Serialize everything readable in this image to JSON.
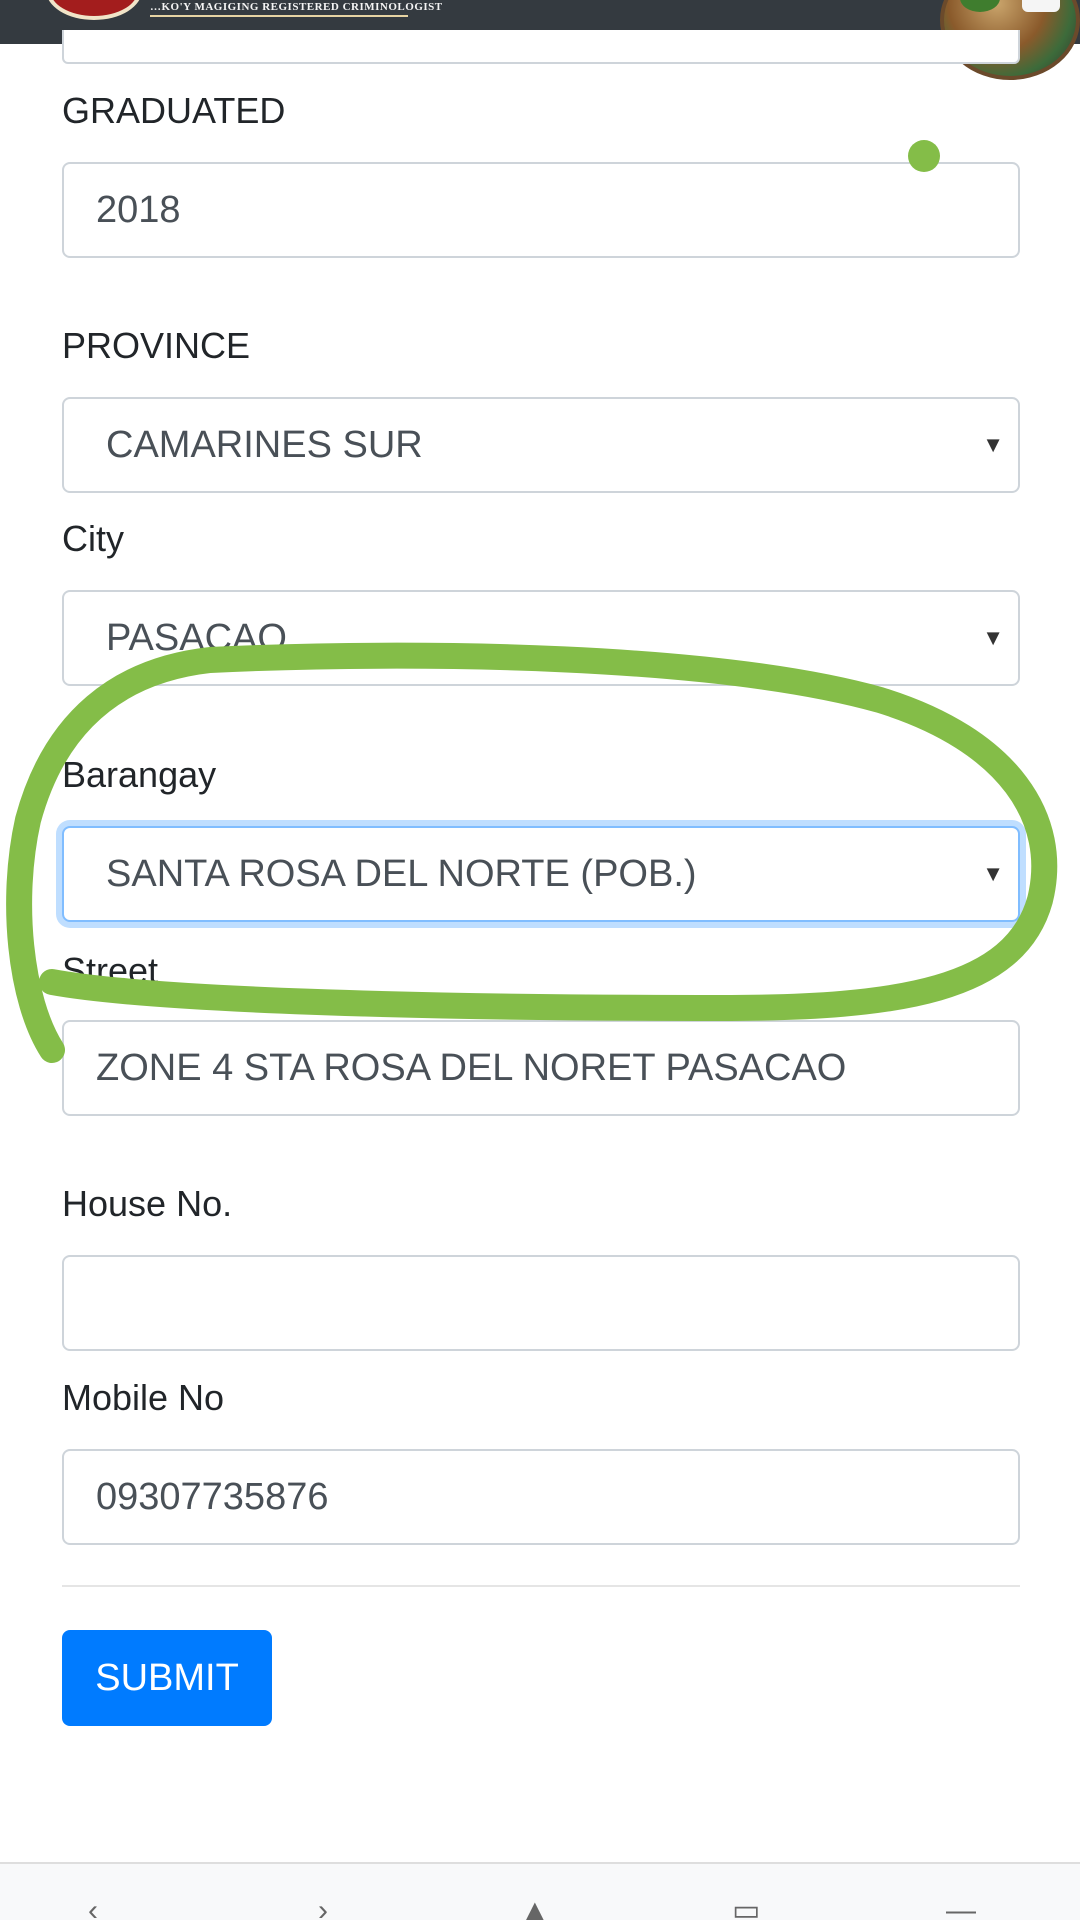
{
  "header": {
    "banner_text": "…KO'Y MAGIGING REGISTERED CRIMINOLOGIST"
  },
  "form": {
    "graduated": {
      "label": "GRADUATED",
      "value": "2018"
    },
    "province": {
      "label": "PROVINCE",
      "value": "CAMARINES SUR"
    },
    "city": {
      "label": "City",
      "value": "PASACAO"
    },
    "barangay": {
      "label": "Barangay",
      "value": "SANTA ROSA DEL NORTE (POB.)"
    },
    "street": {
      "label": "Street",
      "value": "ZONE 4 STA ROSA DEL NORET PASACAO"
    },
    "house_no": {
      "label": "House No.",
      "value": ""
    },
    "mobile_no": {
      "label": "Mobile No",
      "value": "09307735876"
    },
    "submit_label": "SUBMIT"
  },
  "icons": {
    "dropdown": "▼",
    "browser_back": "back-icon",
    "browser_forward": "forward-icon",
    "browser_home": "home-icon",
    "browser_tabs": "tabs-icon",
    "browser_menu": "menu-icon"
  },
  "colors": {
    "primary": "#007bff",
    "annotation_stroke": "#84bd48",
    "topbar": "#343a40"
  }
}
